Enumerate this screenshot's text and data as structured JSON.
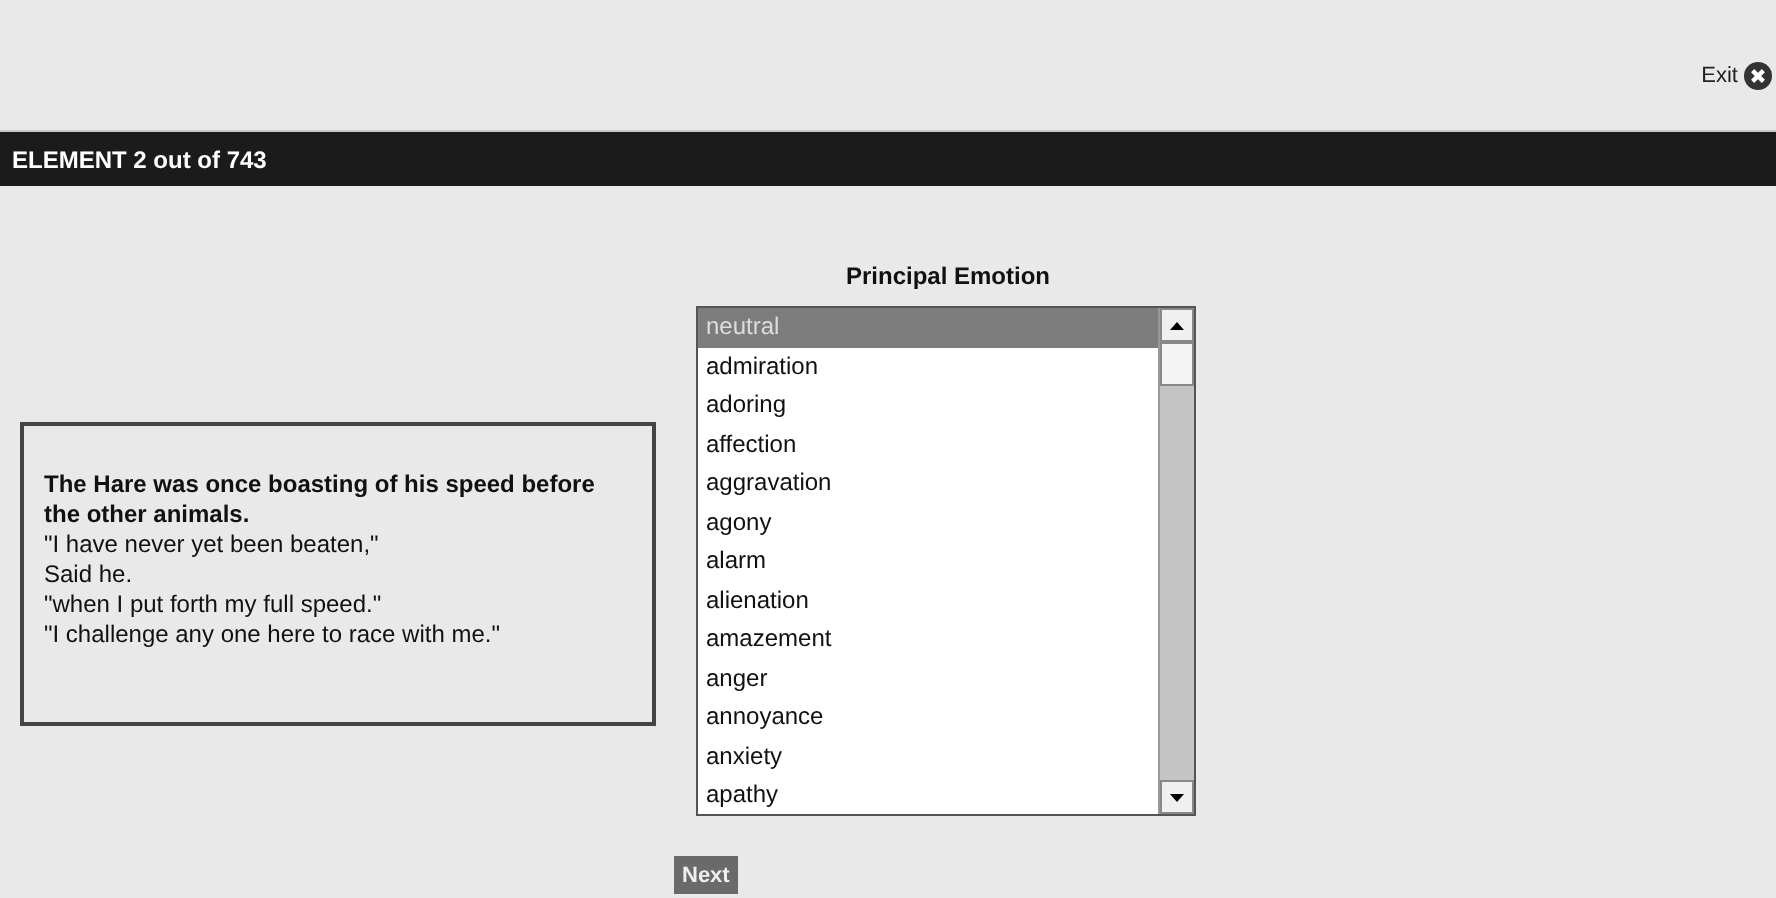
{
  "exit": {
    "label": "Exit"
  },
  "header": {
    "title": "ELEMENT 2 out of 743"
  },
  "story": {
    "heading": "The Hare was once boasting of his speed before the other animals.",
    "lines": [
      "\"I have never yet been beaten,\"",
      "Said he.",
      "\"when I put forth my full speed.\"",
      "\"I challenge any one here to race with me.\""
    ]
  },
  "emotion": {
    "title": "Principal Emotion",
    "options": [
      {
        "label": "neutral",
        "selected": true
      },
      {
        "label": "admiration",
        "selected": false
      },
      {
        "label": "adoring",
        "selected": false
      },
      {
        "label": "affection",
        "selected": false
      },
      {
        "label": "aggravation",
        "selected": false
      },
      {
        "label": "agony",
        "selected": false
      },
      {
        "label": "alarm",
        "selected": false
      },
      {
        "label": "alienation",
        "selected": false
      },
      {
        "label": "amazement",
        "selected": false
      },
      {
        "label": "anger",
        "selected": false
      },
      {
        "label": "annoyance",
        "selected": false
      },
      {
        "label": "anxiety",
        "selected": false
      },
      {
        "label": "apathy",
        "selected": false
      }
    ]
  },
  "next_button": {
    "label": "Next"
  }
}
